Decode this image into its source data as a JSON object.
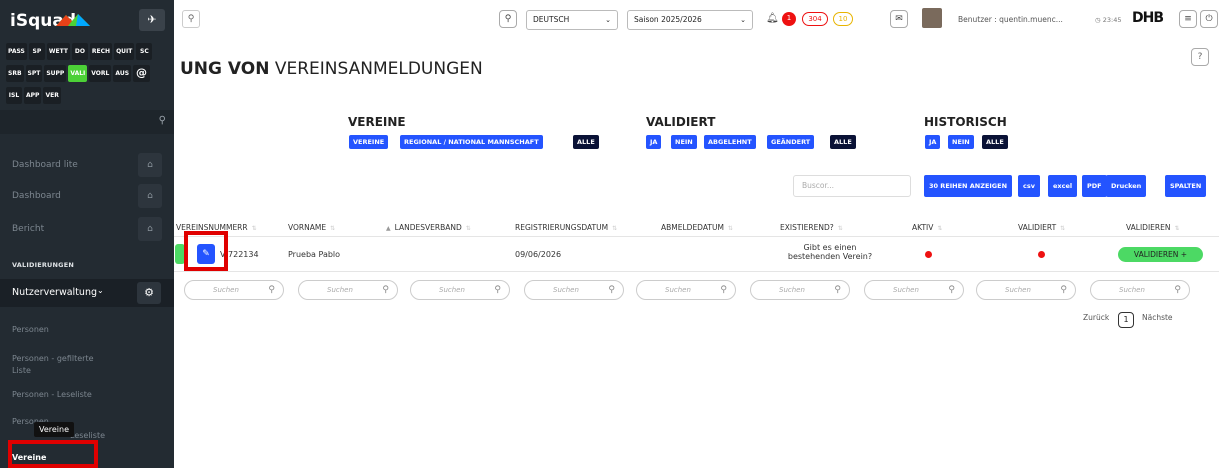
{
  "app": {
    "name": "iSquad"
  },
  "sidebar": {
    "modules_row1": [
      "PASS",
      "SP",
      "WETT",
      "DO",
      "RECH",
      "QUIT",
      "SC"
    ],
    "modules_row2": [
      "SRB",
      "SPT",
      "SUPP",
      "VALI",
      "VORL",
      "AUS",
      "@"
    ],
    "modules_row3": [
      "ISL",
      "APP",
      "VER"
    ],
    "active_module": "VALI",
    "nav": [
      "Dashboard lite",
      "Dashboard",
      "Bericht"
    ],
    "section_label": "VALIDIERUNGEN",
    "nutzer_label": "Nutzerverwaltung",
    "subitems": [
      "Personen",
      "Personen - gefilterte Liste",
      "Personen - Leseliste"
    ],
    "partial_item": "Personen",
    "partial_item2": "Leseliste",
    "tooltip": "Vereine",
    "current_item": "Vereine"
  },
  "topbar": {
    "language": "DEUTSCH",
    "season": "Saison 2025/2026",
    "badge_red": "1",
    "badge_304": "304",
    "badge_10": "10",
    "user": "Benutzer : quentin.muenc...",
    "time": "23:45",
    "org": "DHB"
  },
  "page": {
    "title_bold": "UNG VON",
    "title_rest": " VEREINSANMELDUNGEN",
    "help": "?"
  },
  "filters": {
    "vereine": {
      "title": "VEREINE",
      "options": [
        "VEREINE",
        "REGIONAL / NATIONAL MANNSCHAFT",
        "ALLE"
      ]
    },
    "validiert": {
      "title": "VALIDIERT",
      "options": [
        "JA",
        "NEIN",
        "ABGELEHNT",
        "GEÄNDERT",
        "ALLE"
      ]
    },
    "historisch": {
      "title": "HISTORISCH",
      "options": [
        "JA",
        "NEIN",
        "ALLE"
      ]
    }
  },
  "toolbar": {
    "search_placeholder": "Buscor...",
    "buttons": [
      "30 REIHEN ANZEIGEN",
      "csv",
      "excel",
      "PDF",
      "Drucken",
      "SPALTEN"
    ]
  },
  "table": {
    "columns": [
      "VEREINSNUMMERR",
      "VORNAME",
      "LANDESVERBAND",
      "REGISTRIERUNGSDATUM",
      "ABMELDEDATUM",
      "EXISTIEREND?",
      "AKTIV",
      "VALIDIERT",
      "VALIDIEREN"
    ],
    "row": {
      "number": "V 722134",
      "name": "Prueba Pablo",
      "date": "09/06/2026",
      "existierend_line1": "Gibt es einen",
      "existierend_line2": "bestehenden Verein?",
      "action": "VALIDIEREN +"
    },
    "search_placeholder": "Suchen"
  },
  "pagination": {
    "prev": "Zurück",
    "page": "1",
    "next": "Nächste"
  }
}
